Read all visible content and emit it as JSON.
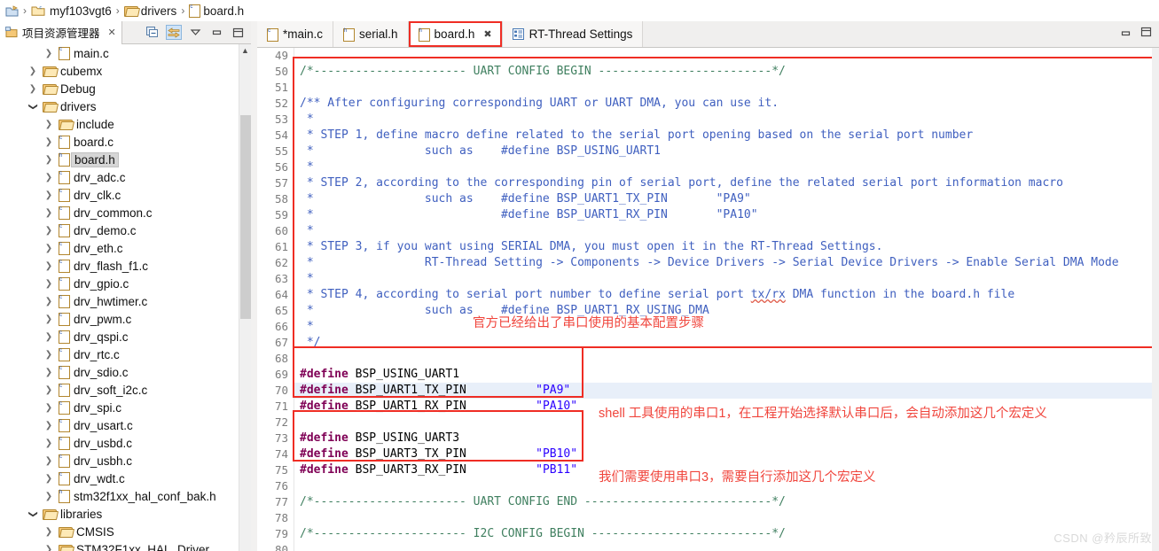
{
  "breadcrumb": {
    "items": [
      {
        "label": "",
        "icon": "workspace-icon"
      },
      {
        "label": "myf103vgt6",
        "icon": "project-folder-icon"
      },
      {
        "label": "drivers",
        "icon": "folder-icon"
      },
      {
        "label": "board.h",
        "icon": "c-file-icon"
      }
    ],
    "separator": "›"
  },
  "left_panel": {
    "tab_label": "项目资源管理器",
    "tab_close": "✕",
    "tools": [
      {
        "name": "collapse-all-icon",
        "label": "Collapse All"
      },
      {
        "name": "link-with-editor-icon",
        "label": "Link with Editor"
      },
      {
        "name": "view-menu-icon",
        "label": "View Menu"
      },
      {
        "name": "minimize-icon",
        "label": "Minimize"
      },
      {
        "name": "maximize-icon",
        "label": "Maximize"
      }
    ],
    "tree": [
      {
        "label": "main.c",
        "indent": 2,
        "icon": "c-file-icon",
        "arrow": "collapsed",
        "selected": false
      },
      {
        "label": "cubemx",
        "indent": 1,
        "icon": "folder-icon",
        "arrow": "collapsed",
        "selected": false
      },
      {
        "label": "Debug",
        "indent": 1,
        "icon": "folder-icon",
        "arrow": "collapsed",
        "selected": false
      },
      {
        "label": "drivers",
        "indent": 1,
        "icon": "folder-icon",
        "arrow": "expanded",
        "selected": false
      },
      {
        "label": "include",
        "indent": 2,
        "icon": "folder-icon",
        "arrow": "collapsed",
        "selected": false
      },
      {
        "label": "board.c",
        "indent": 2,
        "icon": "c-file-icon",
        "arrow": "collapsed",
        "selected": false
      },
      {
        "label": "board.h",
        "indent": 2,
        "icon": "h-file-icon",
        "arrow": "collapsed",
        "selected": true
      },
      {
        "label": "drv_adc.c",
        "indent": 2,
        "icon": "c-file-icon",
        "arrow": "collapsed",
        "selected": false
      },
      {
        "label": "drv_clk.c",
        "indent": 2,
        "icon": "c-file-icon",
        "arrow": "collapsed",
        "selected": false
      },
      {
        "label": "drv_common.c",
        "indent": 2,
        "icon": "c-file-icon",
        "arrow": "collapsed",
        "selected": false
      },
      {
        "label": "drv_demo.c",
        "indent": 2,
        "icon": "c-file-icon",
        "arrow": "collapsed",
        "selected": false
      },
      {
        "label": "drv_eth.c",
        "indent": 2,
        "icon": "c-file-icon",
        "arrow": "collapsed",
        "selected": false
      },
      {
        "label": "drv_flash_f1.c",
        "indent": 2,
        "icon": "c-file-icon",
        "arrow": "collapsed",
        "selected": false
      },
      {
        "label": "drv_gpio.c",
        "indent": 2,
        "icon": "c-file-icon",
        "arrow": "collapsed",
        "selected": false
      },
      {
        "label": "drv_hwtimer.c",
        "indent": 2,
        "icon": "c-file-icon",
        "arrow": "collapsed",
        "selected": false
      },
      {
        "label": "drv_pwm.c",
        "indent": 2,
        "icon": "c-file-icon",
        "arrow": "collapsed",
        "selected": false
      },
      {
        "label": "drv_qspi.c",
        "indent": 2,
        "icon": "c-file-icon",
        "arrow": "collapsed",
        "selected": false
      },
      {
        "label": "drv_rtc.c",
        "indent": 2,
        "icon": "c-file-icon",
        "arrow": "collapsed",
        "selected": false
      },
      {
        "label": "drv_sdio.c",
        "indent": 2,
        "icon": "c-file-icon",
        "arrow": "collapsed",
        "selected": false
      },
      {
        "label": "drv_soft_i2c.c",
        "indent": 2,
        "icon": "c-file-icon",
        "arrow": "collapsed",
        "selected": false
      },
      {
        "label": "drv_spi.c",
        "indent": 2,
        "icon": "c-file-icon",
        "arrow": "collapsed",
        "selected": false
      },
      {
        "label": "drv_usart.c",
        "indent": 2,
        "icon": "c-file-icon",
        "arrow": "collapsed",
        "selected": false
      },
      {
        "label": "drv_usbd.c",
        "indent": 2,
        "icon": "c-file-icon",
        "arrow": "collapsed",
        "selected": false
      },
      {
        "label": "drv_usbh.c",
        "indent": 2,
        "icon": "c-file-icon",
        "arrow": "collapsed",
        "selected": false
      },
      {
        "label": "drv_wdt.c",
        "indent": 2,
        "icon": "c-file-icon",
        "arrow": "collapsed",
        "selected": false
      },
      {
        "label": "stm32f1xx_hal_conf_bak.h",
        "indent": 2,
        "icon": "h-file-icon",
        "arrow": "collapsed",
        "selected": false
      },
      {
        "label": "libraries",
        "indent": 1,
        "icon": "folder-icon",
        "arrow": "expanded",
        "selected": false
      },
      {
        "label": "CMSIS",
        "indent": 2,
        "icon": "folder-icon",
        "arrow": "collapsed",
        "selected": false
      },
      {
        "label": "STM32F1xx_HAL_Driver",
        "indent": 2,
        "icon": "folder-icon",
        "arrow": "collapsed",
        "selected": false
      }
    ]
  },
  "editor": {
    "tabs": [
      {
        "label": "*main.c",
        "icon": "c-file-icon",
        "active": false,
        "dirty": true,
        "closable": false,
        "highlighted": false
      },
      {
        "label": "serial.h",
        "icon": "h-file-icon",
        "active": false,
        "dirty": false,
        "closable": false,
        "highlighted": false
      },
      {
        "label": "board.h",
        "icon": "h-file-icon",
        "active": true,
        "dirty": false,
        "closable": true,
        "highlighted": true
      },
      {
        "label": "RT-Thread Settings",
        "icon": "settings-icon",
        "active": false,
        "dirty": false,
        "closable": false,
        "highlighted": false
      }
    ],
    "tab_close": "✖",
    "window_buttons": [
      {
        "name": "minimize-icon",
        "label": "Minimize"
      },
      {
        "name": "maximize-icon",
        "label": "Maximize"
      }
    ],
    "first_line_number": 49,
    "highlight_line": 70,
    "lines": [
      {
        "n": 49,
        "segs": []
      },
      {
        "n": 50,
        "segs": [
          {
            "t": "/*---------------------- UART CONFIG BEGIN -------------------------*/",
            "c": "c-cmt"
          }
        ]
      },
      {
        "n": 51,
        "segs": []
      },
      {
        "n": 52,
        "segs": [
          {
            "t": "/** After configuring corresponding UART or UART DMA, you can use it.",
            "c": "c-doc"
          }
        ],
        "fold": true
      },
      {
        "n": 53,
        "segs": [
          {
            "t": " *",
            "c": "c-doc"
          }
        ]
      },
      {
        "n": 54,
        "segs": [
          {
            "t": " * STEP 1, define macro define related to the serial port opening based on the serial port number",
            "c": "c-doc"
          }
        ]
      },
      {
        "n": 55,
        "segs": [
          {
            "t": " *                such as    #define BSP_USING_UART1",
            "c": "c-doc"
          }
        ]
      },
      {
        "n": 56,
        "segs": [
          {
            "t": " *",
            "c": "c-doc"
          }
        ]
      },
      {
        "n": 57,
        "segs": [
          {
            "t": " * STEP 2, according to the corresponding pin of serial port, define the related serial port information macro",
            "c": "c-doc"
          }
        ]
      },
      {
        "n": 58,
        "segs": [
          {
            "t": " *                such as    #define BSP_UART1_TX_PIN       \"PA9\"",
            "c": "c-doc"
          }
        ]
      },
      {
        "n": 59,
        "segs": [
          {
            "t": " *                           #define BSP_UART1_RX_PIN       \"PA10\"",
            "c": "c-doc"
          }
        ]
      },
      {
        "n": 60,
        "segs": [
          {
            "t": " *",
            "c": "c-doc"
          }
        ]
      },
      {
        "n": 61,
        "segs": [
          {
            "t": " * STEP 3, if you want using SERIAL DMA, you must open it in the RT-Thread Settings.",
            "c": "c-doc"
          }
        ]
      },
      {
        "n": 62,
        "segs": [
          {
            "t": " *                RT-Thread Setting -> Components -> Device Drivers -> Serial Device Drivers -> Enable Serial DMA Mode",
            "c": "c-doc"
          }
        ]
      },
      {
        "n": 63,
        "segs": [
          {
            "t": " *",
            "c": "c-doc"
          }
        ]
      },
      {
        "n": 64,
        "segs": [
          {
            "t": " * STEP 4, according to serial port number to define serial port ",
            "c": "c-doc"
          },
          {
            "t": "tx/rx",
            "c": "c-doc squig"
          },
          {
            "t": " DMA function in the board.h file",
            "c": "c-doc"
          }
        ]
      },
      {
        "n": 65,
        "segs": [
          {
            "t": " *                such as    #define BSP_UART1_RX_USING_DMA",
            "c": "c-doc"
          }
        ]
      },
      {
        "n": 66,
        "segs": [
          {
            "t": " *",
            "c": "c-doc"
          }
        ]
      },
      {
        "n": 67,
        "segs": [
          {
            "t": " */",
            "c": "c-doc"
          }
        ]
      },
      {
        "n": 68,
        "segs": []
      },
      {
        "n": 69,
        "segs": [
          {
            "t": "#define",
            "c": "c-pp"
          },
          {
            "t": " BSP_USING_UART1",
            "c": "c-id"
          }
        ]
      },
      {
        "n": 70,
        "segs": [
          {
            "t": "#define",
            "c": "c-pp"
          },
          {
            "t": " BSP_UART1_TX_PIN          ",
            "c": "c-id"
          },
          {
            "t": "\"PA9\"",
            "c": "c-str"
          }
        ]
      },
      {
        "n": 71,
        "segs": [
          {
            "t": "#define",
            "c": "c-pp"
          },
          {
            "t": " BSP_UART1_RX_PIN          ",
            "c": "c-id"
          },
          {
            "t": "\"PA10\"",
            "c": "c-str"
          }
        ]
      },
      {
        "n": 72,
        "segs": []
      },
      {
        "n": 73,
        "segs": [
          {
            "t": "#define",
            "c": "c-pp"
          },
          {
            "t": " BSP_USING_UART3",
            "c": "c-id"
          }
        ]
      },
      {
        "n": 74,
        "segs": [
          {
            "t": "#define",
            "c": "c-pp"
          },
          {
            "t": " BSP_UART3_TX_PIN          ",
            "c": "c-id"
          },
          {
            "t": "\"PB10\"",
            "c": "c-str"
          }
        ]
      },
      {
        "n": 75,
        "segs": [
          {
            "t": "#define",
            "c": "c-pp"
          },
          {
            "t": " BSP_UART3_RX_PIN          ",
            "c": "c-id"
          },
          {
            "t": "\"PB11\"",
            "c": "c-str"
          }
        ]
      },
      {
        "n": 76,
        "segs": []
      },
      {
        "n": 77,
        "segs": [
          {
            "t": "/*---------------------- UART CONFIG END ---------------------------*/",
            "c": "c-cmt"
          }
        ]
      },
      {
        "n": 78,
        "segs": []
      },
      {
        "n": 79,
        "segs": [
          {
            "t": "/*---------------------- I2C CONFIG BEGIN --------------------------*/",
            "c": "c-cmt"
          }
        ]
      },
      {
        "n": 80,
        "segs": []
      }
    ]
  },
  "annotations": {
    "color": "#ef2d24",
    "note_steps": "官方已经给出了串口使用的基本配置步骤",
    "note_uart1": "shell 工具使用的串口1，在工程开始选择默认串口后，会自动添加这几个宏定义",
    "note_uart3": "我们需要使用串口3，需要自行添加这几个宏定义"
  },
  "watermark": "CSDN @矜辰所致"
}
